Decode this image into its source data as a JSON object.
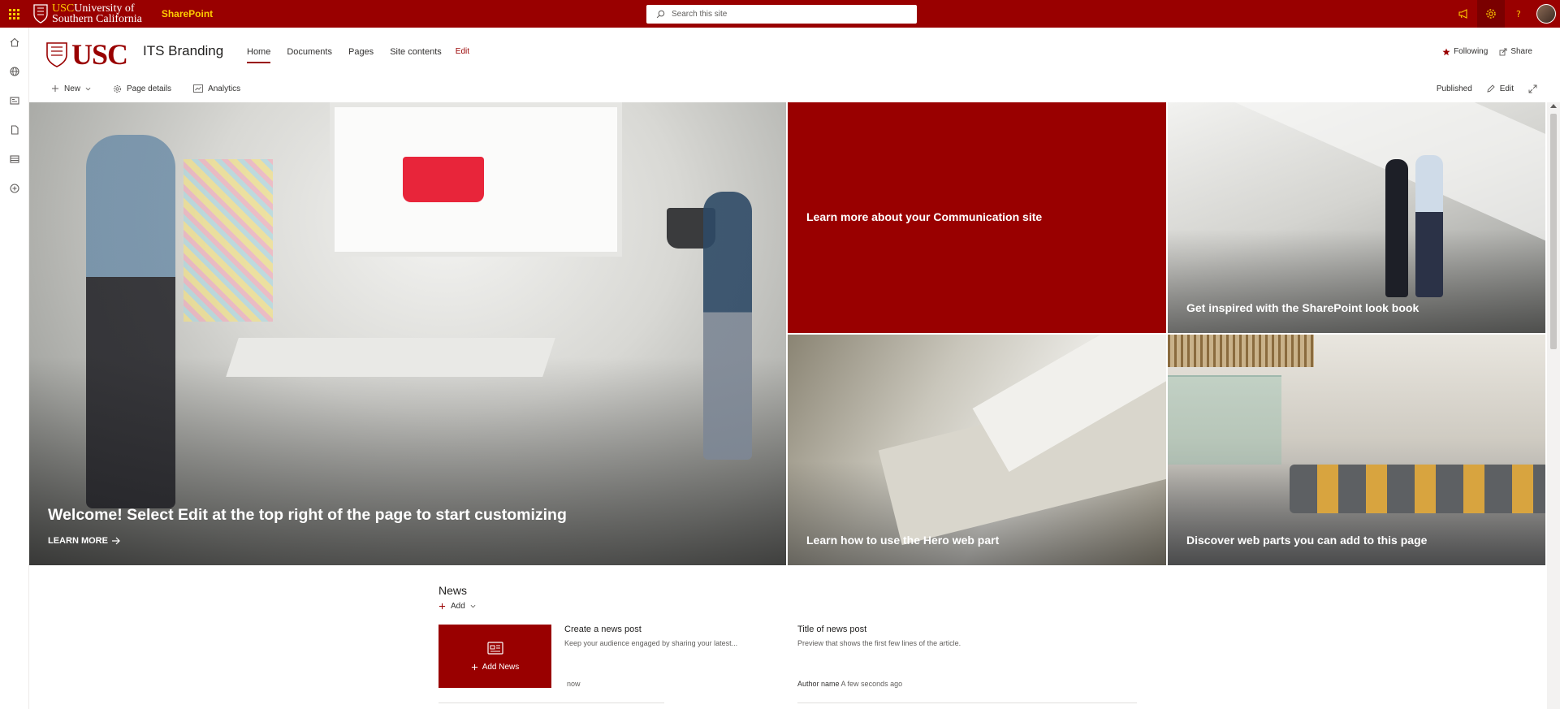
{
  "suite_bar": {
    "brand_line1": "USC",
    "brand_line1b": "University of",
    "brand_line2": "Southern California",
    "app_label": "SharePoint",
    "search_placeholder": "Search this site",
    "icons": [
      "megaphone-icon",
      "gear-icon",
      "help-icon",
      "avatar"
    ],
    "accent": "#990000",
    "gold": "#ffcc00"
  },
  "left_rail": {
    "icons": [
      "home-icon",
      "globe-icon",
      "news-icon",
      "document-icon",
      "list-icon",
      "add-circle-icon"
    ]
  },
  "site_header": {
    "logo_text": "USC",
    "title": "ITS Branding",
    "nav": [
      {
        "label": "Home",
        "active": true
      },
      {
        "label": "Documents"
      },
      {
        "label": "Pages"
      },
      {
        "label": "Site contents"
      },
      {
        "label": "Edit"
      }
    ],
    "following": "Following",
    "share": "Share"
  },
  "command_bar": {
    "new": "New",
    "page_details": "Page details",
    "analytics": "Analytics",
    "published": "Published",
    "edit": "Edit"
  },
  "hero": {
    "main": {
      "title": "Welcome! Select Edit at the top right of the page to start customizing",
      "link": "LEARN MORE"
    },
    "tiles": [
      {
        "title": "Learn more about your Communication site"
      },
      {
        "title": "Get inspired with the SharePoint look book"
      },
      {
        "title": "Learn how to use the Hero web part"
      },
      {
        "title": "Discover web parts you can add to this page"
      }
    ]
  },
  "news": {
    "title": "News",
    "add": "Add",
    "add_news": "Add News",
    "cards": [
      {
        "title": "Create a news post",
        "desc": "Keep your audience engaged by sharing your latest...",
        "author": "",
        "time": "now"
      },
      {
        "title": "Title of news post",
        "desc": "Preview that shows the first few lines of the article.",
        "author": "Author name",
        "time": "A few seconds ago"
      }
    ]
  }
}
